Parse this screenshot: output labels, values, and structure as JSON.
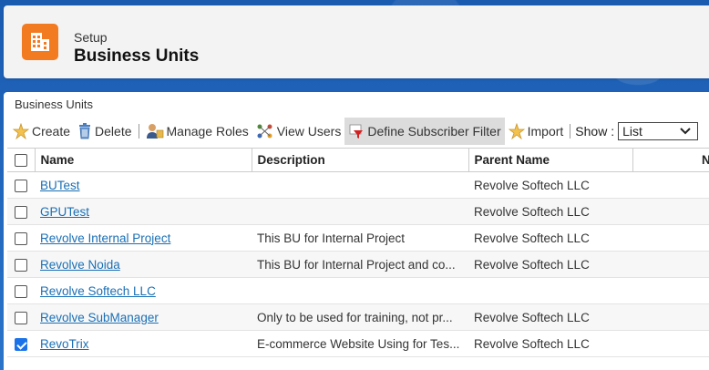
{
  "header": {
    "subtitle": "Setup",
    "title": "Business Units",
    "icon": "building-icon",
    "icon_color": "#f27b21"
  },
  "main": {
    "title": "Business Units"
  },
  "toolbar": {
    "create": "Create",
    "delete": "Delete",
    "manage_roles": "Manage Roles",
    "view_users": "View Users",
    "define_filter": "Define Subscriber Filter",
    "import": "Import",
    "show_label": "Show :",
    "show_value": "List"
  },
  "table": {
    "headers": [
      "Name",
      "Description",
      "Parent Name",
      "Nu"
    ],
    "rows": [
      {
        "name": "BUTest",
        "description": "",
        "parent": "Revolve Softech LLC",
        "checked": false
      },
      {
        "name": "GPUTest",
        "description": "",
        "parent": "Revolve Softech LLC",
        "checked": false
      },
      {
        "name": "Revolve Internal Project",
        "description": "This BU for Internal Project",
        "parent": "Revolve Softech LLC",
        "checked": false
      },
      {
        "name": "Revolve Noida",
        "description": "This BU for Internal Project and co...",
        "parent": "Revolve Softech LLC",
        "checked": false
      },
      {
        "name": "Revolve Softech LLC",
        "description": "",
        "parent": "",
        "checked": false
      },
      {
        "name": "Revolve SubManager",
        "description": "Only to be used for training, not pr...",
        "parent": "Revolve Softech LLC",
        "checked": false
      },
      {
        "name": "RevoTrix",
        "description": "E-commerce Website Using for Tes...",
        "parent": "Revolve Softech LLC",
        "checked": true
      }
    ]
  },
  "colors": {
    "link": "#1a6fb5",
    "background": "#1b5fb0",
    "checkbox_checked": "#1a73e8"
  }
}
